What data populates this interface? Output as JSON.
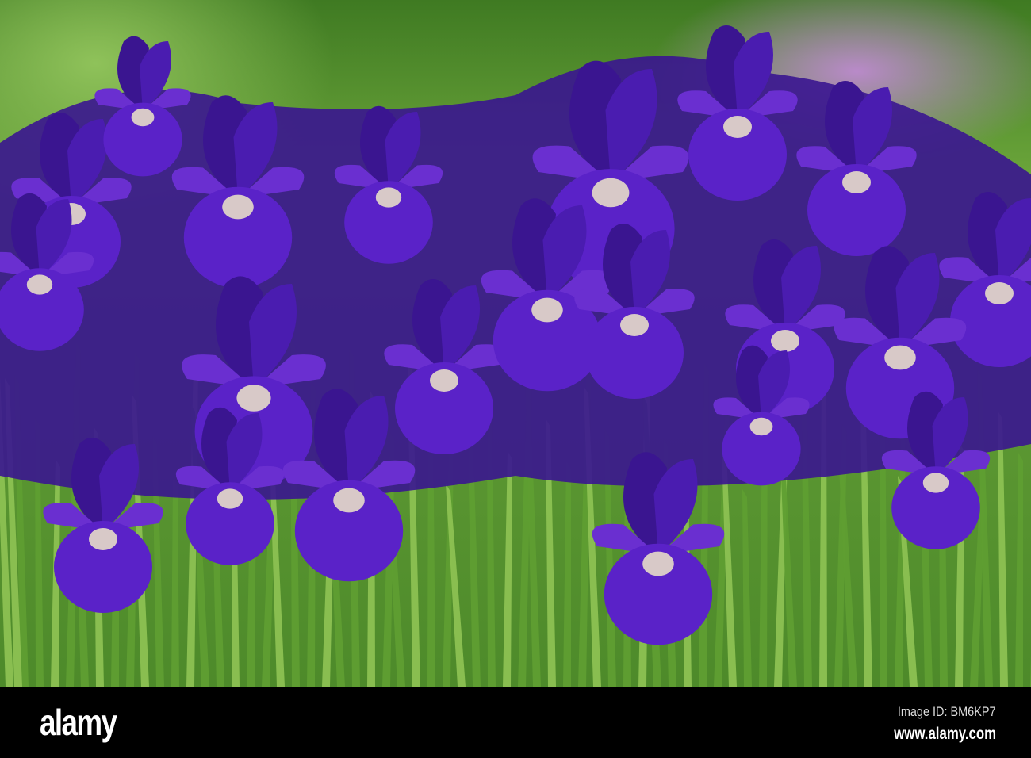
{
  "photo": {
    "subject": "purple-iris-flowers",
    "colors": {
      "petal": "#5a22c8",
      "petal_dark": "#3a1590",
      "stem": "#7cb342",
      "background": "#4d8a2a"
    }
  },
  "footer": {
    "logo": "alamy",
    "image_id": "Image ID: BM6KP7",
    "url": "www.alamy.com"
  }
}
